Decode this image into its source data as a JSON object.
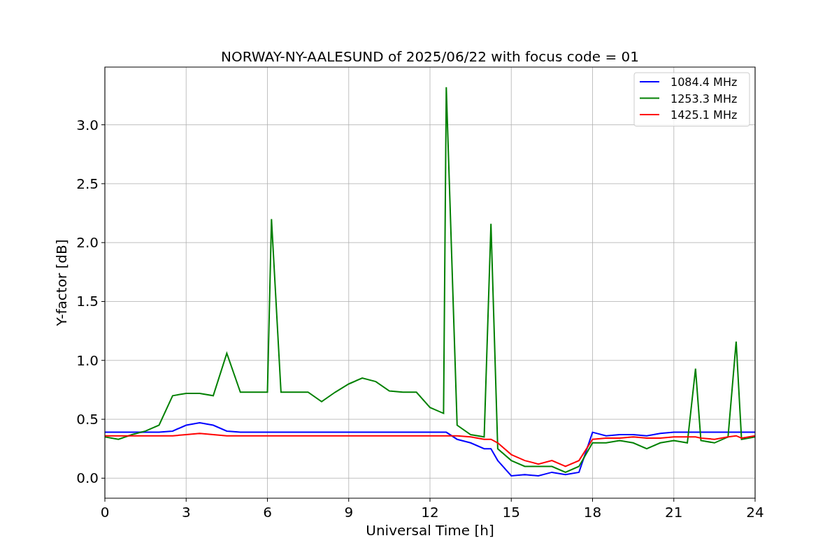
{
  "chart_data": {
    "type": "line",
    "title": "NORWAY-NY-AALESUND of 2025/06/22 with focus code = 01",
    "xlabel": "Universal Time [h]",
    "ylabel": "Y-factor [dB]",
    "x": [
      0,
      0.5,
      1,
      1.5,
      2,
      2.5,
      3,
      3.5,
      4,
      4.5,
      5,
      5.5,
      6,
      6.15,
      6.5,
      7,
      7.5,
      8,
      8.5,
      9,
      9.5,
      10,
      10.5,
      11,
      11.5,
      12,
      12.5,
      12.6,
      13,
      13.5,
      14,
      14.25,
      14.5,
      15,
      15.5,
      16,
      16.5,
      17,
      17.5,
      18,
      18.5,
      19,
      19.5,
      20,
      20.5,
      21,
      21.5,
      21.8,
      22,
      22.5,
      23,
      23.3,
      23.5,
      24
    ],
    "series": [
      {
        "name": "1084.4 MHz",
        "color": "#0000ff",
        "values": [
          0.39,
          0.39,
          0.39,
          0.39,
          0.39,
          0.4,
          0.45,
          0.47,
          0.45,
          0.4,
          0.39,
          0.39,
          0.39,
          0.39,
          0.39,
          0.39,
          0.39,
          0.39,
          0.39,
          0.39,
          0.39,
          0.39,
          0.39,
          0.39,
          0.39,
          0.39,
          0.39,
          0.39,
          0.33,
          0.3,
          0.25,
          0.25,
          0.15,
          0.02,
          0.03,
          0.02,
          0.05,
          0.03,
          0.05,
          0.39,
          0.36,
          0.37,
          0.37,
          0.36,
          0.38,
          0.39,
          0.39,
          0.39,
          0.39,
          0.39,
          0.39,
          0.39,
          0.39,
          0.39
        ]
      },
      {
        "name": "1253.3 MHz",
        "color": "#008000",
        "values": [
          0.35,
          0.33,
          0.37,
          0.4,
          0.45,
          0.7,
          0.72,
          0.72,
          0.7,
          1.06,
          0.73,
          0.73,
          0.73,
          2.2,
          0.73,
          0.73,
          0.73,
          0.65,
          0.73,
          0.8,
          0.85,
          0.82,
          0.74,
          0.73,
          0.73,
          0.6,
          0.55,
          3.32,
          0.45,
          0.37,
          0.35,
          2.16,
          0.25,
          0.15,
          0.1,
          0.1,
          0.1,
          0.05,
          0.1,
          0.3,
          0.3,
          0.32,
          0.3,
          0.25,
          0.3,
          0.32,
          0.3,
          0.93,
          0.32,
          0.3,
          0.35,
          1.16,
          0.33,
          0.35
        ]
      },
      {
        "name": "1425.1 MHz",
        "color": "#ff0000",
        "values": [
          0.36,
          0.36,
          0.36,
          0.36,
          0.36,
          0.36,
          0.37,
          0.38,
          0.37,
          0.36,
          0.36,
          0.36,
          0.36,
          0.36,
          0.36,
          0.36,
          0.36,
          0.36,
          0.36,
          0.36,
          0.36,
          0.36,
          0.36,
          0.36,
          0.36,
          0.36,
          0.36,
          0.36,
          0.36,
          0.35,
          0.33,
          0.33,
          0.3,
          0.2,
          0.15,
          0.12,
          0.15,
          0.1,
          0.15,
          0.33,
          0.34,
          0.34,
          0.35,
          0.34,
          0.34,
          0.35,
          0.35,
          0.35,
          0.34,
          0.33,
          0.35,
          0.36,
          0.34,
          0.36
        ]
      }
    ],
    "grid": true,
    "legend": true,
    "xlim": [
      0,
      24
    ],
    "ylim": [
      -0.17,
      3.49
    ],
    "xticks": [
      0,
      3,
      6,
      9,
      12,
      15,
      18,
      21,
      24
    ],
    "yticks": [
      {
        "value": 0,
        "label": "0.0"
      },
      {
        "value": 0.5,
        "label": "0.5"
      },
      {
        "value": 1,
        "label": "1.0"
      },
      {
        "value": 1.5,
        "label": "1.5"
      },
      {
        "value": 2,
        "label": "2.0"
      },
      {
        "value": 2.5,
        "label": "2.5"
      },
      {
        "value": 3,
        "label": "3.0"
      }
    ]
  }
}
